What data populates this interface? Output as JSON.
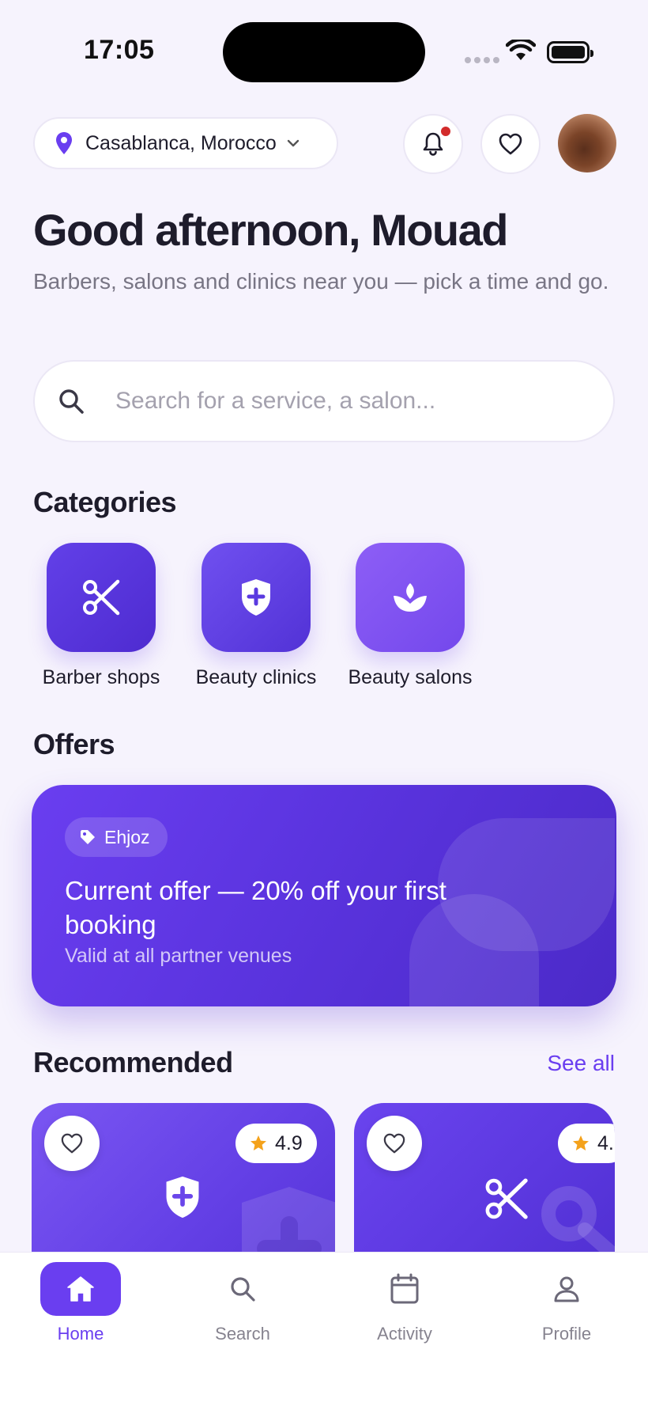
{
  "status_bar": {
    "time": "17:05"
  },
  "header": {
    "location": "Casablanca, Morocco",
    "notification_icon": "bell-icon",
    "favorites_icon": "heart-icon",
    "notification_dot_color": "#d22b2b"
  },
  "greeting": {
    "title": "Good afternoon, Mouad",
    "subtitle": "Barbers, salons and clinics near you — pick a time and go."
  },
  "search": {
    "placeholder": "Search for a service, a salon..."
  },
  "categories": {
    "title": "Categories",
    "items": [
      {
        "label": "Barber shops",
        "icon": "scissors-icon",
        "color": "#5a34dc"
      },
      {
        "label": "Beauty clinics",
        "icon": "shield-plus-icon",
        "color": "#6544e6"
      },
      {
        "label": "Beauty salons",
        "icon": "lotus-icon",
        "color": "#8152f2"
      }
    ]
  },
  "offers": {
    "title": "Offers",
    "tag": "Ehjoz",
    "offer_title": "Current offer — 20% off your first booking",
    "offer_subtitle": "Valid at all partner venues"
  },
  "recommended": {
    "title": "Recommended",
    "see_all": "See all",
    "cards": [
      {
        "rating": "4.9",
        "icon": "shield-plus-icon"
      },
      {
        "rating": "4.",
        "icon": "scissors-icon"
      }
    ]
  },
  "tabbar": {
    "items": [
      {
        "label": "Home",
        "icon": "home-icon",
        "active": true
      },
      {
        "label": "Search",
        "icon": "search-icon",
        "active": false
      },
      {
        "label": "Activity",
        "icon": "calendar-icon",
        "active": false
      },
      {
        "label": "Profile",
        "icon": "user-icon",
        "active": false
      }
    ]
  },
  "colors": {
    "accent": "#6a3ef0",
    "background": "#f6f3fd",
    "star": "#f4a21b"
  }
}
